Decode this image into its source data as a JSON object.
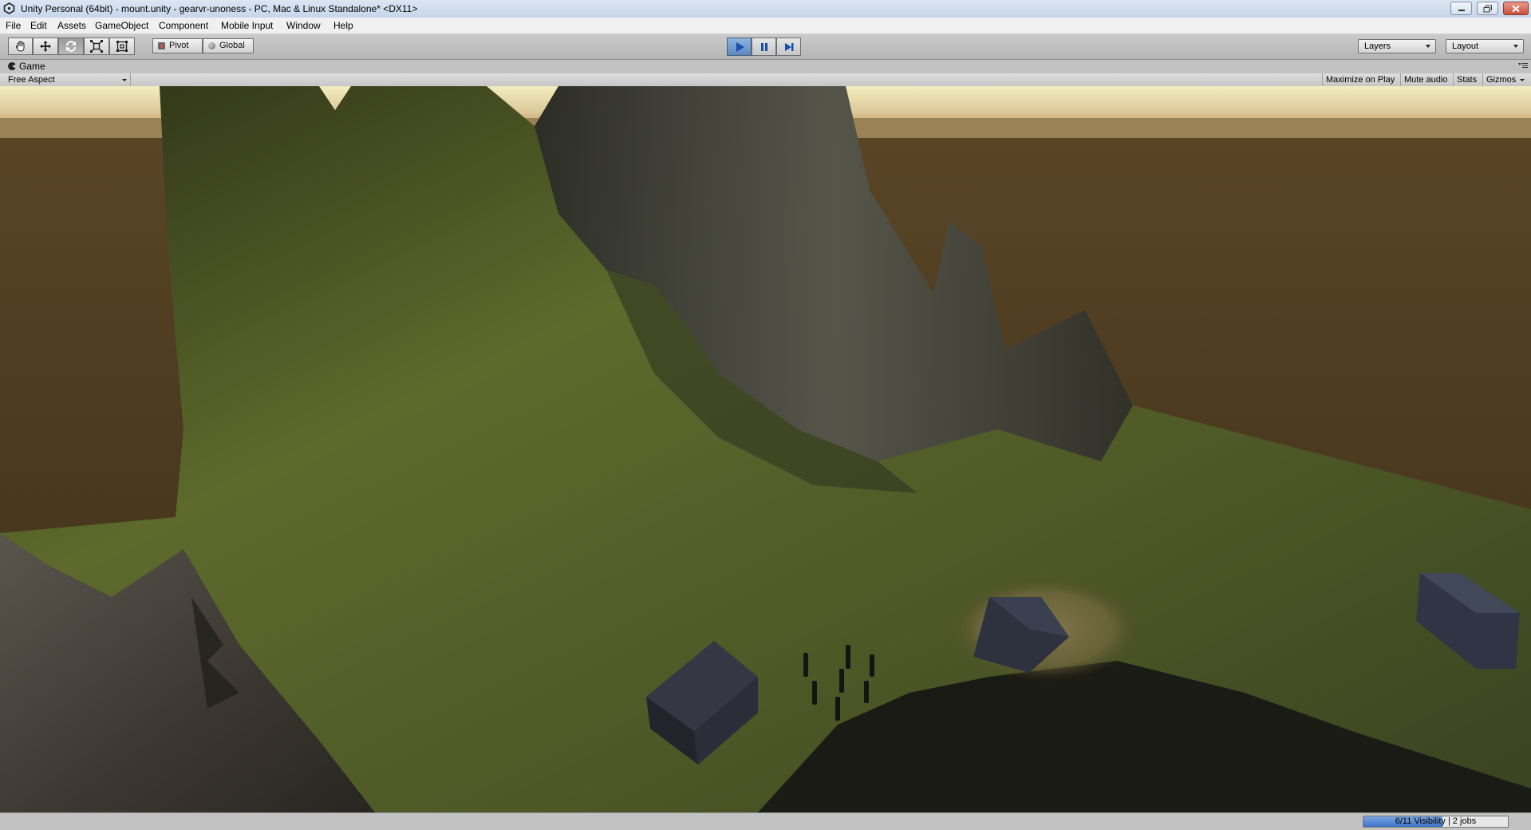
{
  "window": {
    "title": "Unity Personal (64bit) - mount.unity - gearvr-unoness - PC, Mac & Linux Standalone* <DX11>",
    "controls": [
      "minimize-icon",
      "restore-icon",
      "close-icon"
    ]
  },
  "menu": {
    "items": [
      "File",
      "Edit",
      "Assets",
      "GameObject",
      "Component",
      "Mobile Input",
      "Window",
      "Help"
    ]
  },
  "toolbar": {
    "tools": [
      "hand-tool-icon",
      "move-tool-icon",
      "rotate-tool-icon",
      "scale-tool-icon",
      "rect-tool-icon"
    ],
    "active_tool": "rotate-tool-icon",
    "pivot_label": "Pivot",
    "global_label": "Global",
    "playback": [
      "play-icon",
      "pause-icon",
      "step-icon"
    ],
    "playing": true,
    "layers_label": "Layers",
    "layout_label": "Layout",
    "accent_color": "#4f7fc4"
  },
  "game_panel": {
    "tab_label": "Game",
    "aspect_label": "Free Aspect",
    "maximize_label": "Maximize on Play",
    "mute_label": "Mute audio",
    "stats_label": "Stats",
    "gizmos_label": "Gizmos"
  },
  "status": {
    "progress_text": "6/11 Visibility | 2 jobs",
    "progress_fraction": 0.545
  },
  "colors": {
    "sky": "#f0eab8",
    "ground": "#4a3a22",
    "grass": "#5e6a2e",
    "rock": "#3a3a36"
  }
}
